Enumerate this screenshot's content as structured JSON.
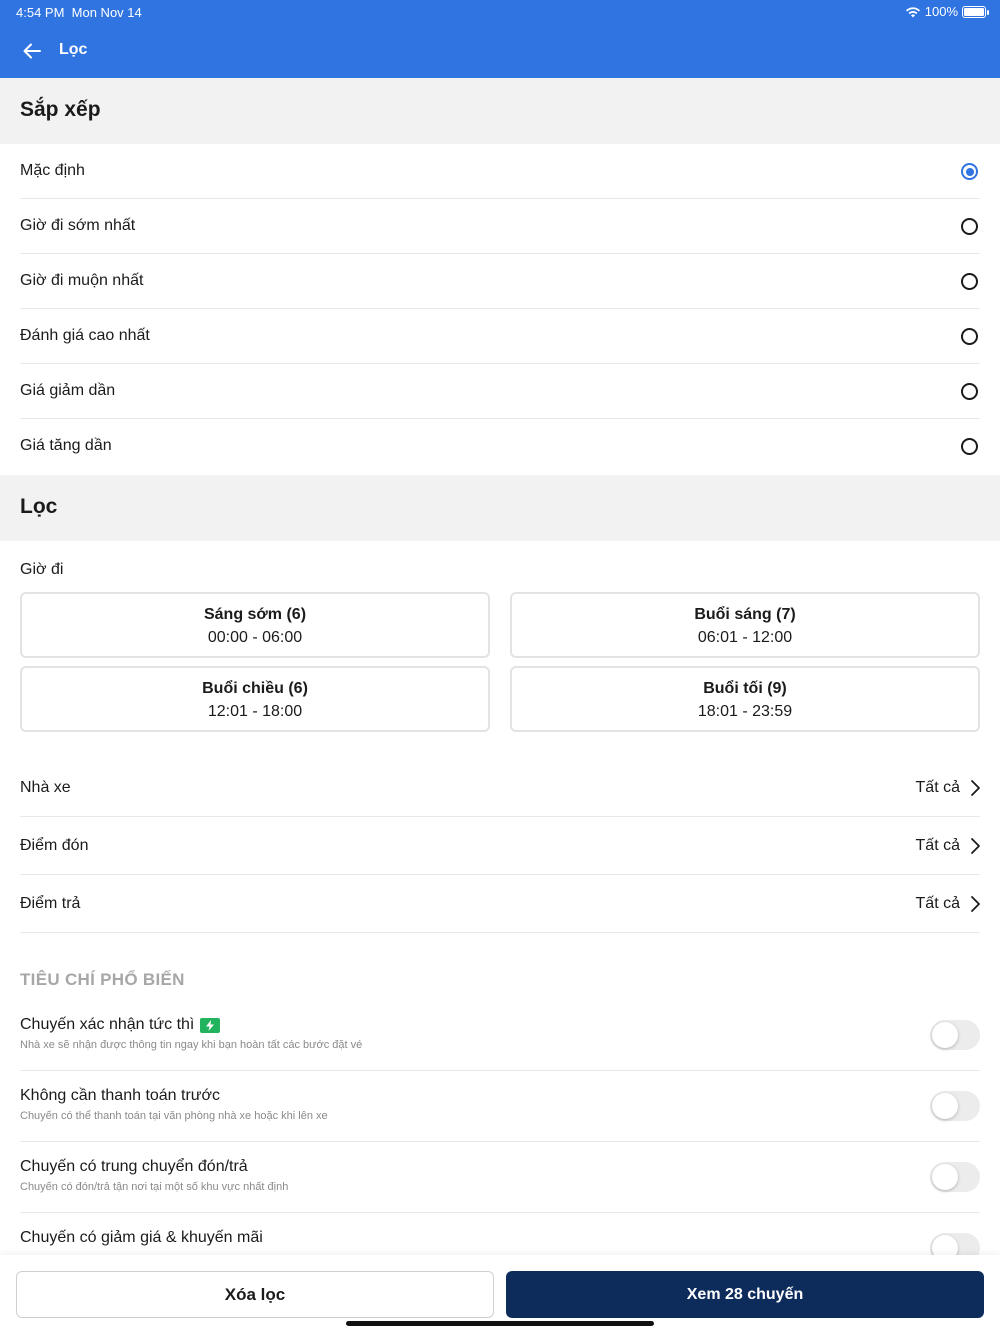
{
  "status_bar": {
    "time": "4:54 PM",
    "date": "Mon Nov 14",
    "battery": "100%"
  },
  "header": {
    "title": "Lọc"
  },
  "sort": {
    "title": "Sắp xếp",
    "options": [
      {
        "label": "Mặc định",
        "selected": true
      },
      {
        "label": "Giờ đi sớm nhất",
        "selected": false
      },
      {
        "label": "Giờ đi muộn nhất",
        "selected": false
      },
      {
        "label": "Đánh giá cao nhất",
        "selected": false
      },
      {
        "label": "Giá giảm dần",
        "selected": false
      },
      {
        "label": "Giá tăng dần",
        "selected": false
      }
    ]
  },
  "filter": {
    "title": "Lọc",
    "departure_label": "Giờ đi",
    "time_slots": [
      {
        "title": "Sáng sớm (6)",
        "range": "00:00 - 06:00"
      },
      {
        "title": "Buổi sáng (7)",
        "range": "06:01 - 12:00"
      },
      {
        "title": "Buổi chiều (6)",
        "range": "12:01 - 18:00"
      },
      {
        "title": "Buổi tối (9)",
        "range": "18:01 - 23:59"
      }
    ],
    "rows": [
      {
        "label": "Nhà xe",
        "value": "Tất cả"
      },
      {
        "label": "Điểm đón",
        "value": "Tất cả"
      },
      {
        "label": "Điểm trả",
        "value": "Tất cả"
      }
    ]
  },
  "popular": {
    "title": "TIÊU CHÍ PHỔ BIẾN",
    "items": [
      {
        "label": "Chuyến xác nhận tức thì",
        "desc": "Nhà xe sẽ nhận được thông tin ngay khi bạn hoàn tất các bước đặt vé",
        "on": false
      },
      {
        "label": "Không cần thanh toán trước",
        "desc": "Chuyến có thể thanh toán tại văn phòng nhà xe hoặc khi lên xe",
        "on": false
      },
      {
        "label": "Chuyến có trung chuyển đón/trả",
        "desc": "Chuyến có đón/trả tận nơi tại một số khu vực nhất định",
        "on": false
      },
      {
        "label": "Chuyến có giảm giá & khuyến mãi",
        "desc": "",
        "on": false
      }
    ]
  },
  "actions": {
    "clear_label": "Xóa lọc",
    "view_label": "Xem 28 chuyến"
  },
  "colors": {
    "primary": "#2f74e0",
    "dark_button": "#0d2c5b",
    "instant_badge": "#22b35e"
  }
}
